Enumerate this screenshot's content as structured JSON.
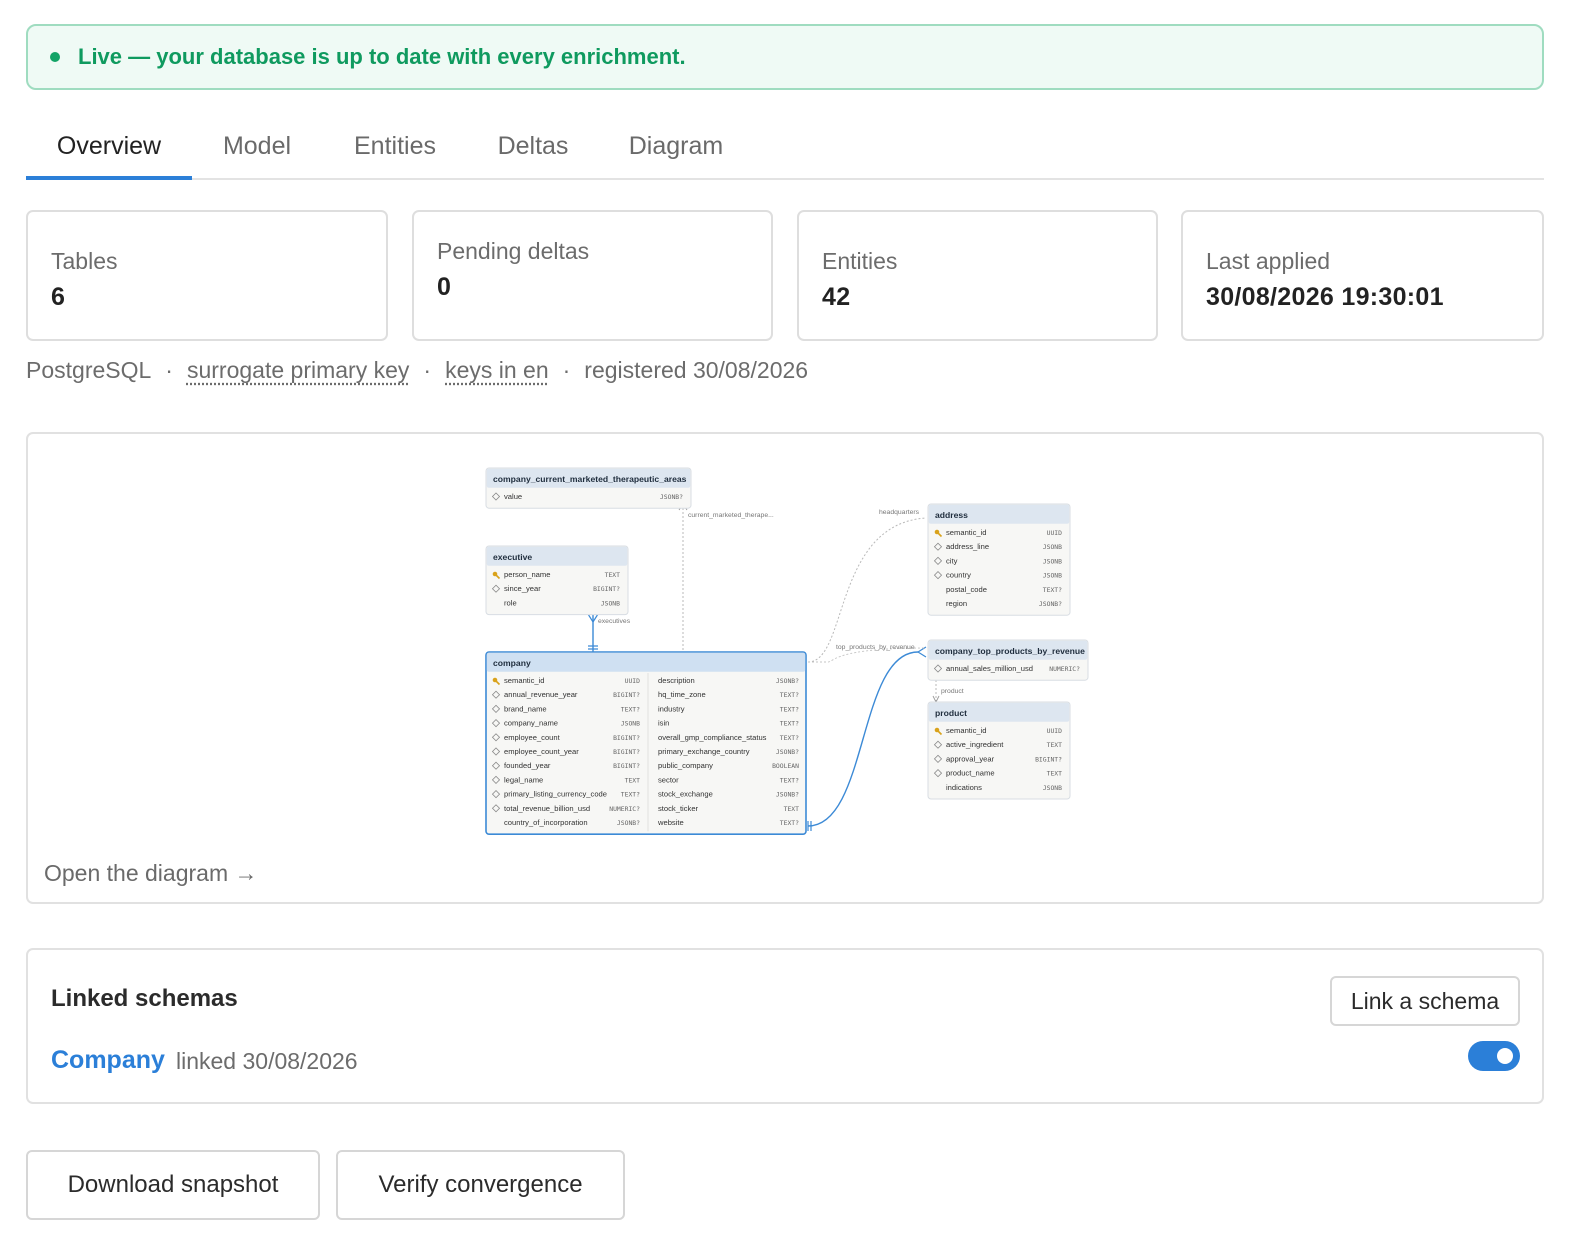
{
  "banner": {
    "message": "Live — your database is up to date with every enrichment."
  },
  "tabs": [
    {
      "label": "Overview",
      "active": true
    },
    {
      "label": "Model"
    },
    {
      "label": "Entities"
    },
    {
      "label": "Deltas"
    },
    {
      "label": "Diagram"
    }
  ],
  "stats": [
    {
      "label": "Tables",
      "value": "6"
    },
    {
      "label": "Pending deltas",
      "value": "0"
    },
    {
      "label": "Entities",
      "value": "42"
    },
    {
      "label": "Last applied",
      "value": "30/08/2026 19:30:01"
    }
  ],
  "meta": {
    "engine": "PostgreSQL",
    "key_strategy": "surrogate primary key",
    "keys_language": "keys in en",
    "registered": "registered 30/08/2026",
    "separator": "·"
  },
  "diagram": {
    "open_link": "Open the diagram →",
    "tables": {
      "therapeutic": {
        "name": "company_current_marketed_therapeutic_areas",
        "columns": [
          {
            "icon": "field",
            "name": "value",
            "type": "JSONB?"
          }
        ]
      },
      "executive": {
        "name": "executive",
        "columns": [
          {
            "icon": "key",
            "name": "person_name",
            "type": "TEXT"
          },
          {
            "icon": "field",
            "name": "since_year",
            "type": "BIGINT?"
          },
          {
            "icon": "",
            "name": "role",
            "type": "JSONB"
          }
        ]
      },
      "address": {
        "name": "address",
        "columns": [
          {
            "icon": "key",
            "name": "semantic_id",
            "type": "UUID"
          },
          {
            "icon": "field",
            "name": "address_line",
            "type": "JSONB"
          },
          {
            "icon": "field",
            "name": "city",
            "type": "JSONB"
          },
          {
            "icon": "field",
            "name": "country",
            "type": "JSONB"
          },
          {
            "icon": "",
            "name": "postal_code",
            "type": "TEXT?"
          },
          {
            "icon": "",
            "name": "region",
            "type": "JSONB?"
          }
        ]
      },
      "top_products": {
        "name": "company_top_products_by_revenue",
        "columns": [
          {
            "icon": "field",
            "name": "annual_sales_million_usd",
            "type": "NUMERIC?"
          }
        ]
      },
      "product": {
        "name": "product",
        "columns": [
          {
            "icon": "key",
            "name": "semantic_id",
            "type": "UUID"
          },
          {
            "icon": "field",
            "name": "active_ingredient",
            "type": "TEXT"
          },
          {
            "icon": "field",
            "name": "approval_year",
            "type": "BIGINT?"
          },
          {
            "icon": "field",
            "name": "product_name",
            "type": "TEXT"
          },
          {
            "icon": "",
            "name": "indications",
            "type": "JSONB"
          }
        ]
      },
      "company": {
        "name": "company",
        "columns_left": [
          {
            "icon": "key",
            "name": "semantic_id",
            "type": "UUID"
          },
          {
            "icon": "field",
            "name": "annual_revenue_year",
            "type": "BIGINT?"
          },
          {
            "icon": "field",
            "name": "brand_name",
            "type": "TEXT?"
          },
          {
            "icon": "field",
            "name": "company_name",
            "type": "JSONB"
          },
          {
            "icon": "field",
            "name": "employee_count",
            "type": "BIGINT?"
          },
          {
            "icon": "field",
            "name": "employee_count_year",
            "type": "BIGINT?"
          },
          {
            "icon": "field",
            "name": "founded_year",
            "type": "BIGINT?"
          },
          {
            "icon": "field",
            "name": "legal_name",
            "type": "TEXT"
          },
          {
            "icon": "field",
            "name": "primary_listing_currency_code",
            "type": "TEXT?"
          },
          {
            "icon": "field",
            "name": "total_revenue_billion_usd",
            "type": "NUMERIC?"
          },
          {
            "icon": "",
            "name": "country_of_incorporation",
            "type": "JSONB?"
          }
        ],
        "columns_right": [
          {
            "name": "description",
            "type": "JSONB?"
          },
          {
            "name": "hq_time_zone",
            "type": "TEXT?"
          },
          {
            "name": "industry",
            "type": "TEXT?"
          },
          {
            "name": "isin",
            "type": "TEXT?"
          },
          {
            "name": "overall_gmp_compliance_status",
            "type": "TEXT?"
          },
          {
            "name": "primary_exchange_country",
            "type": "JSONB?"
          },
          {
            "name": "public_company",
            "type": "BOOLEAN"
          },
          {
            "name": "sector",
            "type": "TEXT?"
          },
          {
            "name": "stock_exchange",
            "type": "JSONB?"
          },
          {
            "name": "stock_ticker",
            "type": "TEXT"
          },
          {
            "name": "website",
            "type": "TEXT?"
          }
        ]
      }
    },
    "relations": {
      "current_marketed": "current_marketed_therape...",
      "executives": "executives",
      "headquarters": "headquarters",
      "top_products": "top_products_by_revenue",
      "product": "product"
    },
    "colors": {
      "header": "#dde6f0",
      "body": "#f7f7f5",
      "company_header": "#cfe0f2",
      "accent": "#3c8ad6",
      "key": "#d9a21b"
    }
  },
  "linked_schemas": {
    "title": "Linked schemas",
    "link_button": "Link a schema",
    "items": [
      {
        "name": "Company",
        "linked": "linked 30/08/2026",
        "enabled": true
      }
    ]
  },
  "actions": {
    "download": "Download snapshot",
    "verify": "Verify convergence"
  },
  "colors": {
    "accent": "#2b7fd8",
    "success": "#0f9a5f"
  }
}
